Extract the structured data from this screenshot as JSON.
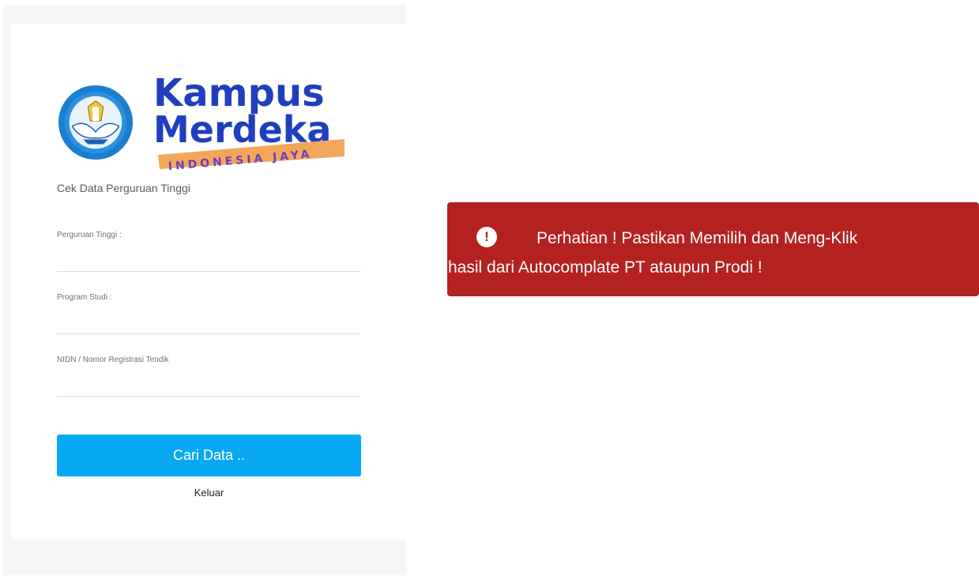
{
  "logo": {
    "brand_line1": "Kampus",
    "brand_line2": "Merdeka",
    "brand_ribbon": "INDONESIA JAYA",
    "seal_icon": "tut-wuri-handayani-seal-icon",
    "colors": {
      "brand_blue": "#1f3fbf",
      "ribbon": "#f2a65a",
      "ribbon_text": "#6b3fbf"
    }
  },
  "form": {
    "subtitle": "Cek Data Perguruan Tinggi",
    "fields": [
      {
        "label": "Perguruan Tinggi :",
        "value": ""
      },
      {
        "label": "Program Studi :",
        "value": ""
      },
      {
        "label": "NIDN / Nomor Registrasi Tendik",
        "value": ""
      }
    ],
    "search_button": "Cari Data ..",
    "logout_link": "Keluar",
    "colors": {
      "button": "#08a9f2"
    }
  },
  "alert": {
    "icon": "exclamation-circle-icon",
    "line1": "Perhatian ! Pastikan Memilih dan Meng-Klik",
    "line2": "hasil dari Autocomplate PT ataupun Prodi !",
    "colors": {
      "background": "#b42121"
    }
  }
}
